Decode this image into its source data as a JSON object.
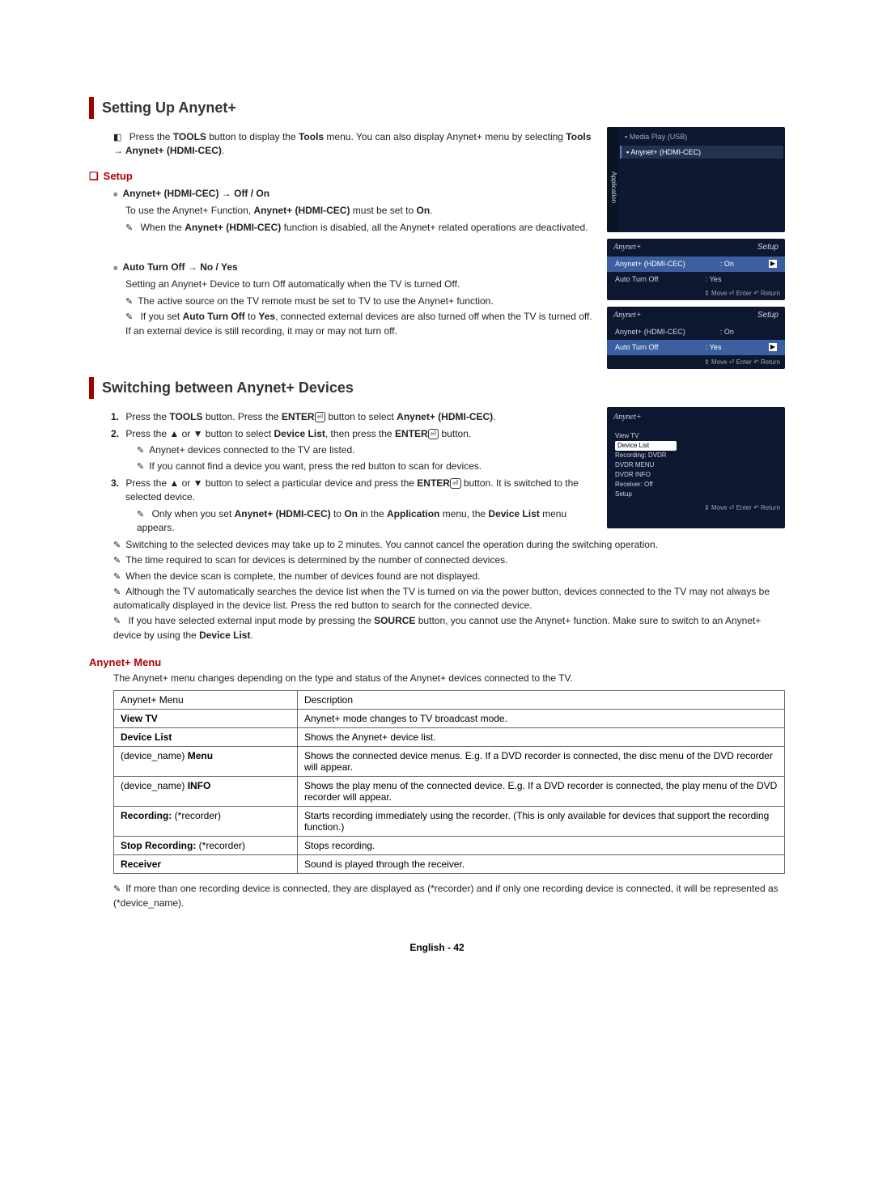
{
  "section1": {
    "title": "Setting Up Anynet+",
    "intro_a": "Press the ",
    "intro_b": "TOOLS",
    "intro_c": " button to display the ",
    "intro_d": "Tools",
    "intro_e": " menu. You can also display Anynet+ menu by selecting ",
    "intro_f": "Tools → Anynet+ (HDMI-CEC)",
    "intro_g": ".",
    "setup_heading": "Setup",
    "item1_title": "Anynet+ (HDMI-CEC) → Off / On",
    "item1_line_a": "To use the Anynet+ Function, ",
    "item1_line_b": "Anynet+ (HDMI-CEC)",
    "item1_line_c": " must be set to ",
    "item1_line_d": "On",
    "item1_line_e": ".",
    "item1_note_a": "When the ",
    "item1_note_b": "Anynet+ (HDMI-CEC)",
    "item1_note_c": " function is disabled, all the Anynet+ related operations are deactivated.",
    "item2_title": "Auto Turn Off → No / Yes",
    "item2_line": "Setting an Anynet+ Device to turn Off automatically when the TV is turned Off.",
    "item2_note1": "The active source on the TV remote must be set to TV to use the Anynet+ function.",
    "item2_note2_a": "If you set ",
    "item2_note2_b": "Auto Turn Off",
    "item2_note2_c": " to ",
    "item2_note2_d": "Yes",
    "item2_note2_e": ", connected external devices are also turned off when the TV is turned off. If an external device is still recording, it may or may not turn off."
  },
  "section2": {
    "title": "Switching between Anynet+ Devices",
    "step1_a": "Press the ",
    "step1_b": "TOOLS",
    "step1_c": " button. Press the ",
    "step1_d": "ENTER",
    "step1_e": " button to select ",
    "step1_f": "Anynet+ (HDMI-CEC)",
    "step1_g": ".",
    "step2_a": "Press the ▲ or ▼ button to select ",
    "step2_b": "Device List",
    "step2_c": ", then press the ",
    "step2_d": "ENTER",
    "step2_e": " button.",
    "step2_note1": "Anynet+ devices connected to the TV are listed.",
    "step2_note2": "If you cannot find a device you want, press the red button to scan for devices.",
    "step3_a": "Press the ▲ or ▼ button to select a particular device and press the ",
    "step3_b": "ENTER",
    "step3_c": " button. It is switched to the selected device.",
    "step3_note_a": "Only when you set ",
    "step3_note_b": "Anynet+ (HDMI-CEC)",
    "step3_note_c": " to ",
    "step3_note_d": "On",
    "step3_note_e": " in the ",
    "step3_note_f": "Application",
    "step3_note_g": " menu, the ",
    "step3_note_h": "Device List",
    "step3_note_i": " menu appears.",
    "noteA": "Switching to the selected devices may take up to 2 minutes. You cannot cancel the operation during the switching operation.",
    "noteB": "The time required to scan for devices is determined by the number of connected devices.",
    "noteC": "When the device scan is complete, the number of devices found are not displayed.",
    "noteD": "Although the TV automatically searches the device list when the TV is turned on via the power button, devices connected to the TV may not always be automatically displayed in the device list. Press the red button to search for the connected device.",
    "noteE_a": "If you have selected external input mode by pressing the ",
    "noteE_b": "SOURCE",
    "noteE_c": " button, you cannot use the Anynet+ function. Make sure to switch to an Anynet+ device by using the ",
    "noteE_d": "Device List",
    "noteE_e": "."
  },
  "menu": {
    "heading": "Anynet+ Menu",
    "caption": "The Anynet+ menu changes depending on the type and status of the Anynet+ devices connected to the TV.",
    "header_col1": "Anynet+ Menu",
    "header_col2": "Description",
    "rows": [
      {
        "c1_a": "View TV",
        "c2": "Anynet+ mode changes to TV broadcast mode."
      },
      {
        "c1_a": "Device List",
        "c2": "Shows the Anynet+ device list."
      },
      {
        "c1_pre": "(device_name) ",
        "c1_b": "Menu",
        "c2": "Shows the connected device menus. E.g. If a DVD recorder is connected, the disc menu of the DVD recorder will appear."
      },
      {
        "c1_pre": "(device_name) ",
        "c1_b": "INFO",
        "c2": "Shows the play menu of the connected device. E.g. If a DVD recorder is connected, the play menu of the DVD recorder will appear."
      },
      {
        "c1_b": "Recording:",
        "c1_post": " (*recorder)",
        "c2": "Starts recording immediately using the recorder. (This is only available for devices that support the recording function.)"
      },
      {
        "c1_b": "Stop Recording:",
        "c1_post": " (*recorder)",
        "c2": "Stops recording."
      },
      {
        "c1_a": "Receiver",
        "c2": "Sound is played through the receiver."
      }
    ],
    "footnote": "If more than one recording device is connected, they are displayed as (*recorder) and if only one recording device is connected, it will be represented as (*device_name)."
  },
  "osd": {
    "app": {
      "tab": "Application",
      "row1": "Media Play (USB)",
      "row2": "Anynet+ (HDMI-CEC)"
    },
    "setup_title": "Setup",
    "logo": "Anynet+",
    "r_cec_label": "Anynet+ (HDMI-CEC)",
    "r_cec_val": ": On",
    "r_ato_label": "Auto Turn Off",
    "r_ato_val": ": Yes",
    "nav": "⇕ Move    ⏎ Enter    ↶ Return",
    "dev": {
      "items": [
        "View TV",
        "Device List",
        "Recording: DVDR",
        "DVDR MENU",
        "DVDR INFO",
        "Receiver: Off",
        "Setup"
      ],
      "sel_index": 1
    }
  },
  "footer": {
    "lang": "English - ",
    "page": "42"
  }
}
